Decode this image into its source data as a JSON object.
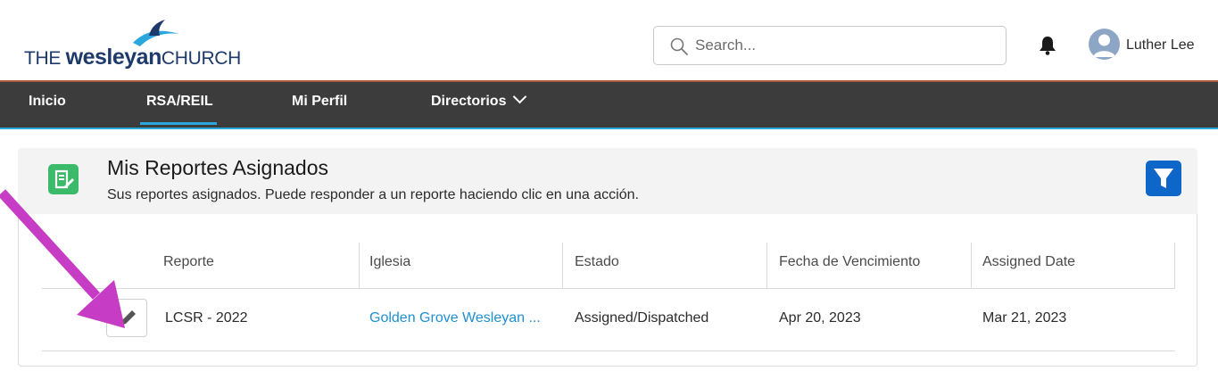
{
  "header": {
    "logo": {
      "the": "THE",
      "wesleyan": "wesleyan",
      "church": "CHURCH"
    },
    "search": {
      "placeholder": "Search..."
    },
    "user": {
      "name": "Luther Lee"
    },
    "icons": [
      "search-icon",
      "bell-icon",
      "user-avatar-icon"
    ]
  },
  "nav": {
    "items": [
      {
        "label": "Inicio"
      },
      {
        "label": "RSA/REIL",
        "active": true
      },
      {
        "label": "Mi Perfil"
      },
      {
        "label": "Directorios"
      }
    ]
  },
  "card": {
    "title": "Mis Reportes Asignados",
    "subtitle": "Sus reportes asignados. Puede responder a un reporte haciendo clic en una acción.",
    "icons": [
      "report-edit-icon",
      "filter-icon"
    ]
  },
  "table": {
    "columns": [
      "Reporte",
      "Iglesia",
      "Estado",
      "Fecha de Vencimiento",
      "Assigned Date"
    ],
    "rows": [
      {
        "reporte": "LCSR - 2022",
        "iglesia": "Golden Grove Wesleyan ...",
        "estado": "Assigned/Dispatched",
        "vencimiento": "Apr 20, 2023",
        "assigned": "Mar 21, 2023"
      }
    ]
  },
  "colors": {
    "brand_navy": "#1d3a6b",
    "brand_sky": "#2aa7dd",
    "nav_bg": "#3c3c3c",
    "filter_blue": "#0e66c9",
    "report_green": "#3bba6a",
    "link_blue": "#1f8fd1",
    "annotation_magenta": "#c63cc4"
  }
}
